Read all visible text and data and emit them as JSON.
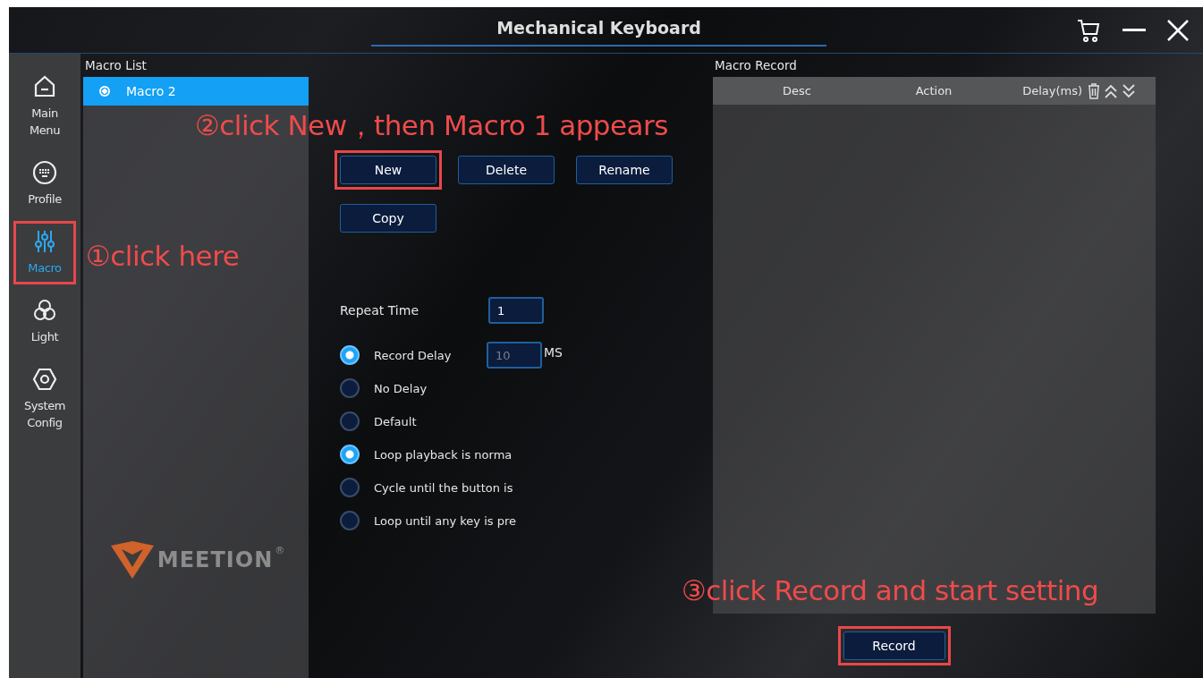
{
  "window": {
    "title": "Mechanical Keyboard"
  },
  "sidebar": {
    "items": [
      {
        "label": "Main Menu",
        "selected": false,
        "highlighted": false
      },
      {
        "label": "Profile",
        "selected": false,
        "highlighted": false
      },
      {
        "label": "Macro",
        "selected": true,
        "highlighted": true
      },
      {
        "label": "Light",
        "selected": false,
        "highlighted": false
      },
      {
        "label": "System Config",
        "selected": false,
        "highlighted": false
      }
    ]
  },
  "logo": {
    "text": "MEETION",
    "mark": "®"
  },
  "macro_list": {
    "title": "Macro List",
    "items": [
      {
        "label": "Macro 2",
        "selected": true
      }
    ]
  },
  "actions": [
    {
      "label": "New",
      "highlighted": true
    },
    {
      "label": "Delete"
    },
    {
      "label": "Rename"
    },
    {
      "label": "Copy"
    }
  ],
  "repeat_time": {
    "label": "Repeat Time",
    "value": "1"
  },
  "delay_options": [
    {
      "label": "Record Delay",
      "selected": true,
      "placeholder": "10",
      "unit": "MS"
    },
    {
      "label": "No Delay",
      "selected": false
    },
    {
      "label": "Default",
      "selected": false
    }
  ],
  "loop_options": [
    {
      "label": "Loop playback is norma",
      "selected": true
    },
    {
      "label": "Cycle until the button is",
      "selected": false
    },
    {
      "label": "Loop until any key is pre",
      "selected": false
    }
  ],
  "macro_record": {
    "title": "Macro Record",
    "columns": [
      "Desc",
      "Action",
      "Delay(ms)"
    ],
    "button": {
      "label": "Record",
      "highlighted": true
    }
  },
  "annotations": [
    {
      "text": "②click New，then Macro 1 appears"
    },
    {
      "text": "①click here"
    },
    {
      "text": "③click Record and start setting"
    }
  ]
}
